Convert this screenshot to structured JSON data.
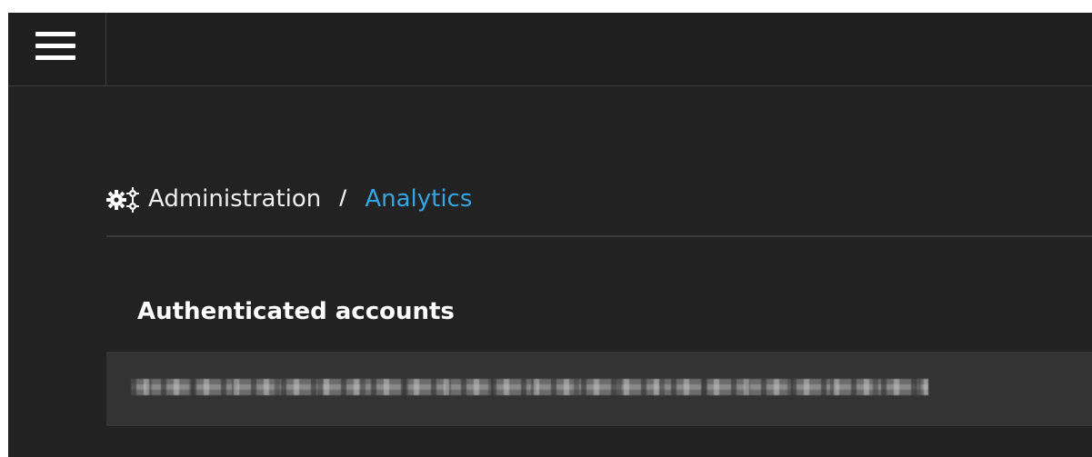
{
  "header": {
    "menu_icon": "hamburger-menu-icon"
  },
  "breadcrumb": {
    "icon": "cogs-icon",
    "parent_label": "Administration",
    "separator": "/",
    "current_label": "Analytics"
  },
  "section": {
    "title": "Authenticated accounts"
  },
  "colors": {
    "background": "#222222",
    "topbar": "#1f1f1f",
    "row": "#333333",
    "link": "#35a4e4",
    "text": "#eeeeee"
  }
}
